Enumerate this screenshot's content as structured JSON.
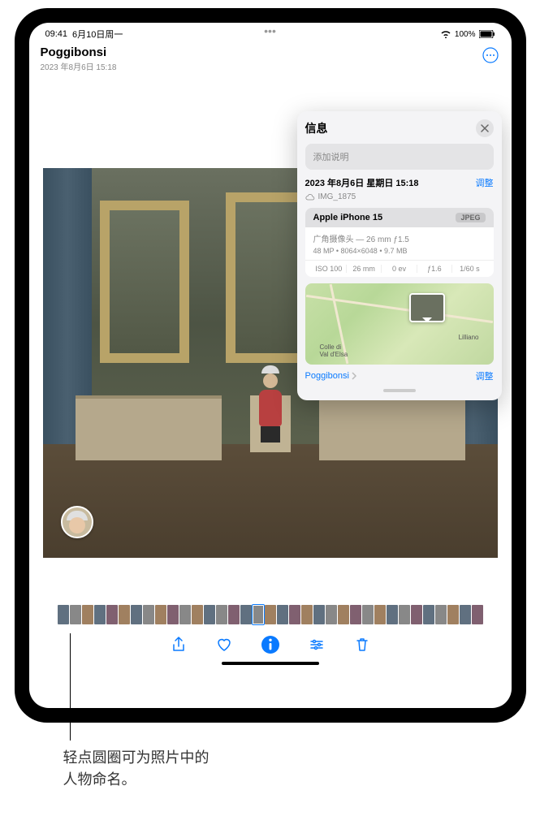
{
  "status": {
    "time": "09:41",
    "date": "6月10日周一",
    "battery": "100%"
  },
  "header": {
    "title": "Poggibonsi",
    "subtitle": "2023 年8月6日 15:18"
  },
  "info_panel": {
    "title": "信息",
    "caption_placeholder": "添加说明",
    "date_full": "2023 年8月6日 星期日 15:18",
    "adjust": "调整",
    "filename": "IMG_1875",
    "camera": {
      "device": "Apple iPhone 15",
      "format": "JPEG",
      "lens": "广角摄像头 — 26 mm ƒ1.5",
      "megapixels": "48 MP",
      "resolution": "8064×6048",
      "filesize": "9.7 MB",
      "iso": "ISO 100",
      "focal": "26 mm",
      "ev": "0 ev",
      "aperture": "ƒ1.6",
      "shutter": "1/60 s"
    },
    "map": {
      "place1": "Colle di\nVal d'Elsa",
      "place2": "Lilliano",
      "location_link": "Poggibonsi",
      "adjust": "调整"
    }
  },
  "callout": {
    "line1": "轻点圆圈可为照片中的",
    "line2": "人物命名。"
  }
}
